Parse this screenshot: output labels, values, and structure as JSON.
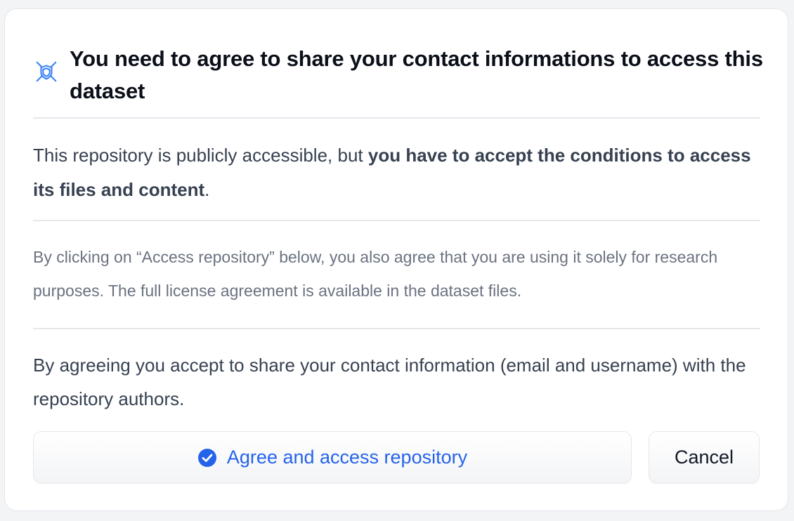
{
  "dialog": {
    "title": "You need to agree to share your contact informations to access this dataset",
    "title_icon": "shield-gate-icon",
    "intro_plain": "This repository is publicly accessible, but ",
    "intro_bold": "you have to accept the conditions to access its files and content",
    "intro_end": ".",
    "note": "By clicking on “Access repository” below, you also agree that you are using it solely for research purposes. The full license agreement is available in the dataset files.",
    "consent": "By agreeing you accept to share your contact information (email and username) with the repository authors.",
    "agree_button_label": "Agree and access repository",
    "agree_button_icon": "check-circle-icon",
    "cancel_button_label": "Cancel"
  },
  "colors": {
    "accent": "#2563eb",
    "text": "#374151",
    "muted": "#6b7280",
    "border": "#e5e7eb"
  }
}
